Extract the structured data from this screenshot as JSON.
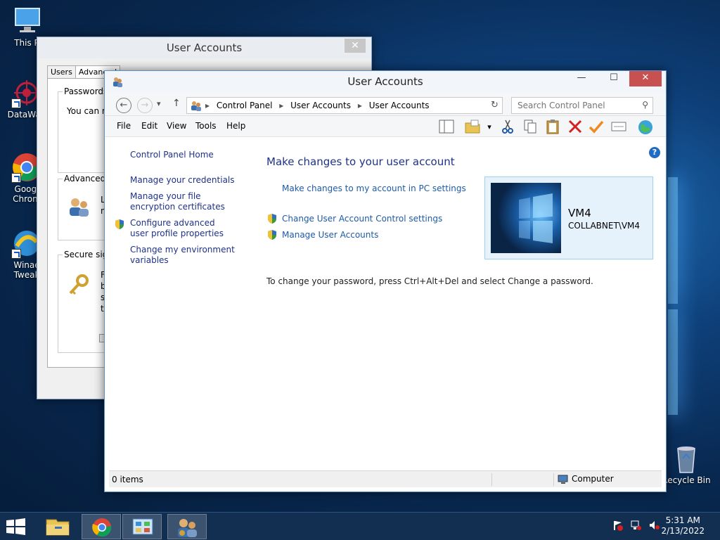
{
  "desktop": {
    "icons": [
      {
        "label": "This P"
      },
      {
        "label": "DataWag"
      },
      {
        "label": "Googl Chrom"
      },
      {
        "label": "Winae Tweak"
      },
      {
        "label": "Recycle Bin"
      }
    ]
  },
  "back_window": {
    "title": "User Accounts",
    "close": "✕",
    "tabs": [
      "Users",
      "Advanced"
    ],
    "groups": {
      "passwords": {
        "title": "Passwords",
        "text": "You can m"
      },
      "advanced": {
        "title": "Advanced",
        "text_line1": "L",
        "text_line2": "n"
      },
      "secure": {
        "title": "Secure sign",
        "lines": [
          "F",
          "b",
          "s",
          "th"
        ]
      }
    }
  },
  "window": {
    "title": "User Accounts",
    "controls": {
      "minimize": "—",
      "maximize": "☐",
      "close": "✕"
    },
    "address": {
      "back": "←",
      "forward": "→",
      "dropdown": "▾",
      "up": "↑",
      "crumbs": [
        "Control Panel",
        "User Accounts",
        "User Accounts"
      ],
      "separator": "▸",
      "addr_dropdown": "▾",
      "refresh": "↻",
      "search_placeholder": "Search Control Panel",
      "search_icon": "⚲"
    },
    "menu": [
      "File",
      "Edit",
      "View",
      "Tools",
      "Help"
    ],
    "toolbar_icons": [
      "layout-icon",
      "folder-options-icon",
      "dropdown-icon",
      "cut-icon",
      "copy-icon",
      "paste-icon",
      "delete-icon",
      "checkmark-icon",
      "properties-icon",
      "globe-icon"
    ],
    "help": "?",
    "left_pane": {
      "home": "Control Panel Home",
      "links": [
        {
          "label": "Manage your credentials"
        },
        {
          "label": "Manage your file encryption certificates"
        },
        {
          "label": "Configure advanced user profile properties"
        },
        {
          "label": "Change my environment variables"
        }
      ]
    },
    "content": {
      "heading": "Make changes to your user account",
      "pc_settings_link": "Make changes to my account in PC settings",
      "uac_link": "Change User Account Control settings",
      "manage_link": "Manage User Accounts",
      "account": {
        "name": "VM4",
        "domain": "COLLABNET\\VM4"
      },
      "password_text": "To change your password, press Ctrl+Alt+Del and select Change a password."
    },
    "status": {
      "items": "0 items",
      "zone": "Computer"
    }
  },
  "taskbar": {
    "apps": [
      "file-explorer-icon",
      "chrome-icon",
      "control-panel-icon",
      "user-accounts-icon"
    ],
    "clock": {
      "time": "5:31 AM",
      "date": "2/13/2022"
    }
  }
}
